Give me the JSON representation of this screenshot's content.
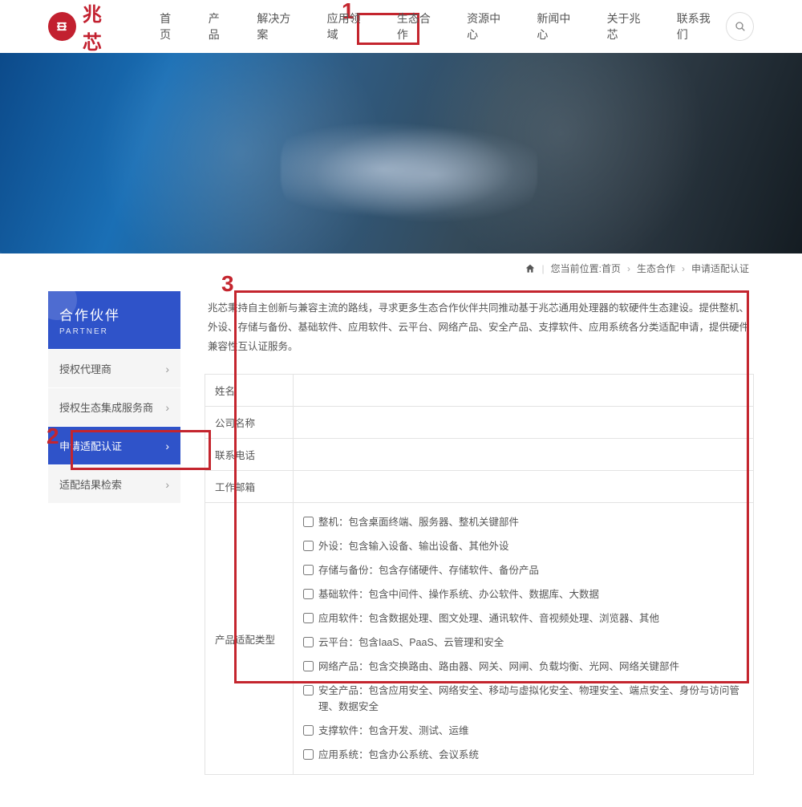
{
  "logo": {
    "text": "兆芯",
    "symbol": "᚛ᚑ"
  },
  "nav": [
    "首页",
    "产品",
    "解决方案",
    "应用领域",
    "生态合作",
    "资源中心",
    "新闻中心",
    "关于兆芯",
    "联系我们"
  ],
  "breadcrumb": {
    "label": "您当前位置:首页",
    "a": "生态合作",
    "b": "申请适配认证"
  },
  "sidebar": {
    "title_zh": "合作伙伴",
    "title_en": "PARTNER",
    "items": [
      {
        "label": "授权代理商",
        "active": false
      },
      {
        "label": "授权生态集成服务商",
        "active": false
      },
      {
        "label": "申请适配认证",
        "active": true
      },
      {
        "label": "适配结果检索",
        "active": false
      }
    ]
  },
  "intro": "兆芯秉持自主创新与兼容主流的路线，寻求更多生态合作伙伴共同推动基于兆芯通用处理器的软硬件生态建设。提供整机、外设、存储与备份、基础软件、应用软件、云平台、网络产品、安全产品、支撑软件、应用系统各分类适配申请，提供硬件兼容性互认证服务。",
  "form_labels": {
    "name": "姓名",
    "company": "公司名称",
    "phone": "联系电话",
    "email": "工作邮箱",
    "category": "产品适配类型"
  },
  "checkboxes": [
    "整机：包含桌面终端、服务器、整机关键部件",
    "外设：包含输入设备、输出设备、其他外设",
    "存储与备份：包含存储硬件、存储软件、备份产品",
    "基础软件：包含中间件、操作系统、办公软件、数据库、大数据",
    "应用软件：包含数据处理、图文处理、通讯软件、音视频处理、浏览器、其他",
    "云平台：包含IaaS、PaaS、云管理和安全",
    "网络产品：包含交换路由、路由器、网关、网闸、负载均衡、光网、网络关键部件",
    "安全产品：包含应用安全、网络安全、移动与虚拟化安全、物理安全、端点安全、身份与访问管理、数据安全",
    "支撑软件：包含开发、测试、运维",
    "应用系统：包含办公系统、会议系统"
  ],
  "annotations": {
    "n1": "1",
    "n2": "2",
    "n3": "3"
  }
}
